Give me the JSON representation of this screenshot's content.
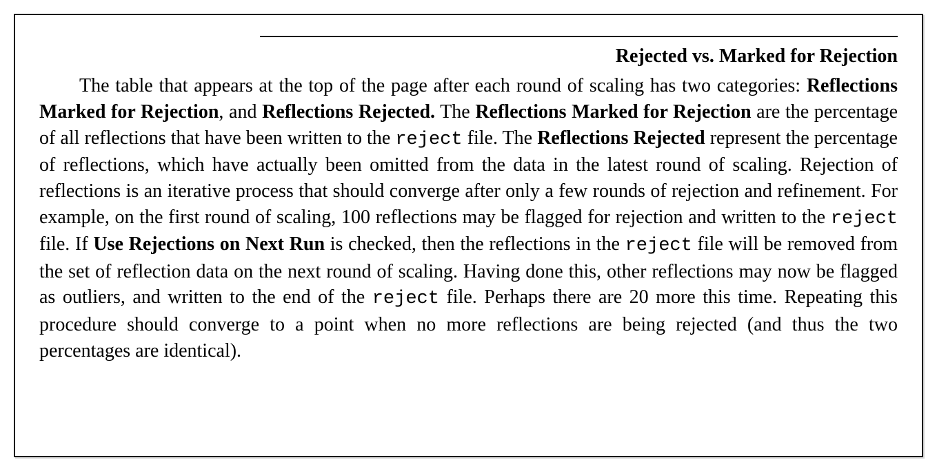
{
  "heading": "Rejected vs. Marked for Rejection",
  "body": {
    "t1": "The table that appears at the top of the page after each round of scaling has two categories: ",
    "b1": "Reflections Marked for Rejection",
    "t2": ", and ",
    "b2": "Reflections Rejected.",
    "t3": " The ",
    "b3": "Reflections Marked for Rejection",
    "t4": " are the percentage of all reflections that have been written to the ",
    "c1": "reject",
    "t5": " file. The ",
    "b4": "Reflections Rejected",
    "t6": " represent the percentage of reflections, which have actually been omitted from the data in the latest round of scaling. Rejection of reflections is an iterative process that should converge after only a few rounds of rejection and refinement. For example, on the first round of scaling, 100 reflections may be flagged for rejection and written to the ",
    "c2": "reject",
    "t7": " file. If ",
    "b5": "Use Rejections on Next Run",
    "t8": " is checked, then the reflections in the ",
    "c3": "reject",
    "t9": " file will be removed from the set of reflection data on the next round of scaling. Having done this, other reflections may now be flagged as outliers, and written to the end of the ",
    "c4": "reject",
    "t10": " file. Perhaps there are 20 more this time. Repeating this procedure should converge to a point when no more reflections are being rejected (and thus the two percentages are identical)."
  }
}
